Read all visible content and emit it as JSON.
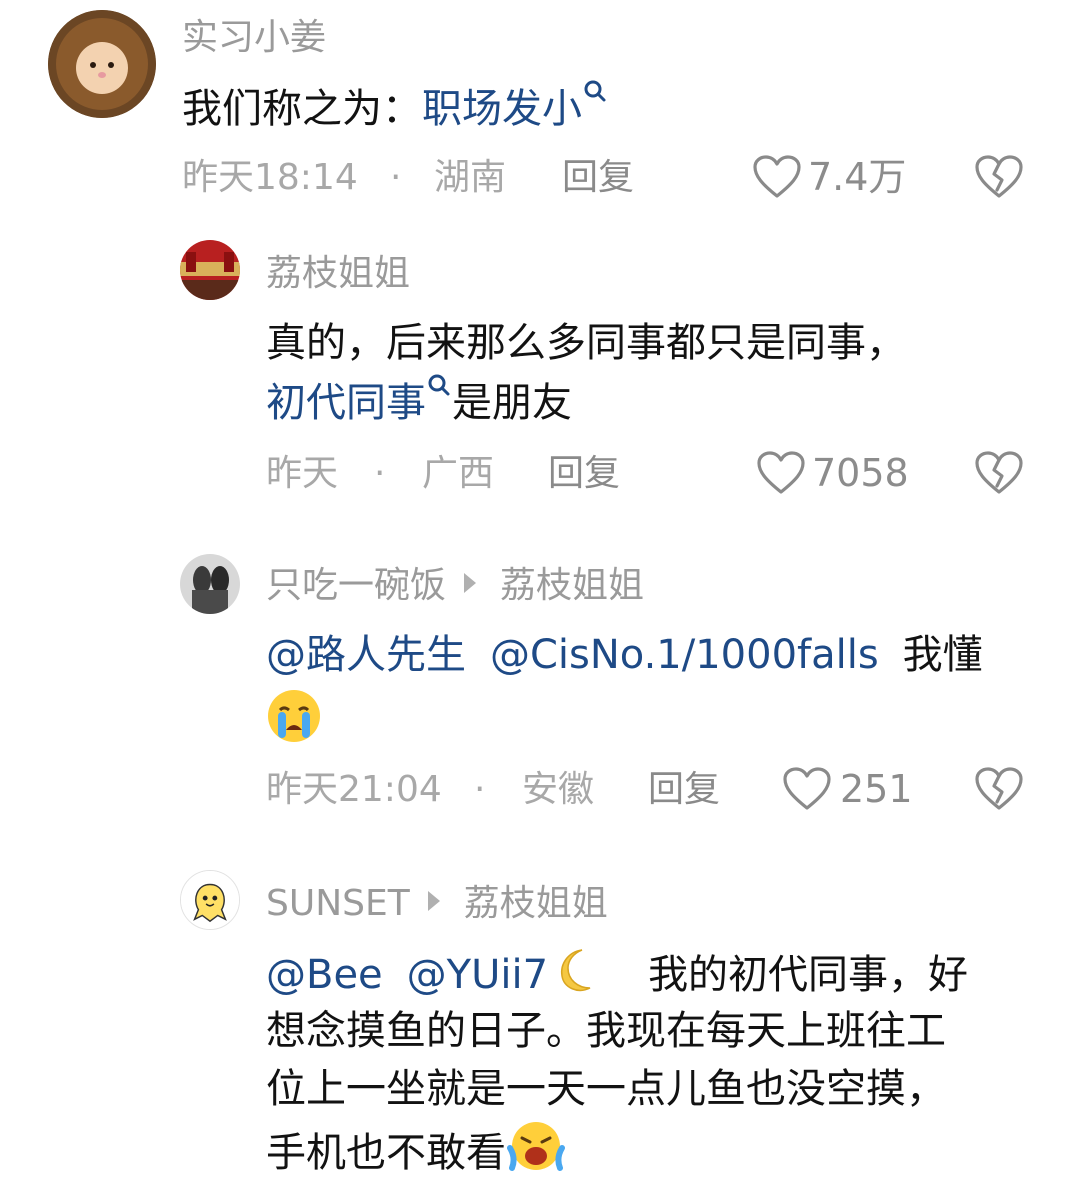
{
  "comments": [
    {
      "username": "实习小姜",
      "text_plain": "我们称之为：",
      "link": "职场发小",
      "time": "昨天18:14",
      "dot": "·",
      "location": "湖南",
      "reply": "回复",
      "likes": "7.4万"
    },
    {
      "username": "荔枝姐姐",
      "text_line1": "真的，后来那么多同事都只是同事，",
      "link": "初代同事",
      "text_after": "是朋友",
      "time": "昨天",
      "dot": "·",
      "location": "广西",
      "reply": "回复",
      "likes": "7058"
    },
    {
      "username": "只吃一碗饭",
      "reply_to": "荔枝姐姐",
      "mention1": "@路人先生",
      "mention2": "@CisNo.1/1000falls",
      "text": "我懂",
      "time": "昨天21:04",
      "dot": "·",
      "location": "安徽",
      "reply": "回复",
      "likes": "251"
    },
    {
      "username": "SUNSET",
      "reply_to": "荔枝姐姐",
      "mention1": "@Bee",
      "mention2": "@YUii7",
      "text_line1": "我的初代同事，好",
      "text_line2": "想念摸鱼的日子。我现在每天上班往工",
      "text_line3": "位上一坐就是一天一点儿鱼也没空摸，",
      "text_line4": "手机也不敢看"
    }
  ],
  "icons": {
    "like": "heart-outline-icon",
    "dislike": "broken-heart-icon",
    "search": "search-icon"
  },
  "colors": {
    "link": "#1e4a86",
    "meta": "#a8a8a8",
    "username": "#9a9a9a"
  }
}
